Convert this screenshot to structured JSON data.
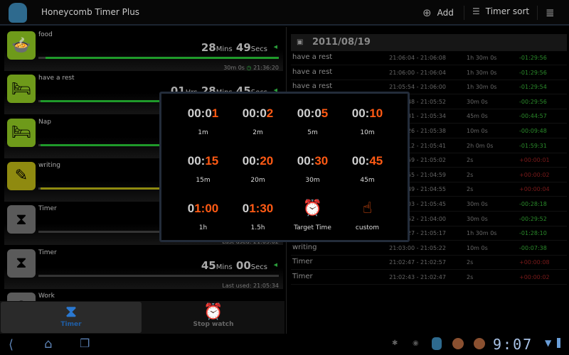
{
  "header": {
    "title": "Honeycomb Timer Plus",
    "add_label": "Add",
    "sort_label": "Timer sort"
  },
  "timers": [
    {
      "name": "food",
      "icon": "pot-icon",
      "color": "#6e9a1a",
      "bar": "#1f9a2a",
      "progress": 0.97,
      "h": null,
      "m": "28",
      "s": "49",
      "footer": "30m 0s",
      "end": "21:36:20"
    },
    {
      "name": "have a rest",
      "icon": "bed-icon",
      "color": "#6e9a1a",
      "bar": "#1f9a2a",
      "progress": 0.99,
      "h": "01",
      "m": "28",
      "s": "45",
      "footer": null
    },
    {
      "name": "Nap",
      "icon": "bed-icon",
      "color": "#6e9a1a",
      "bar": "#1f9a2a",
      "progress": 0.99,
      "footer": null
    },
    {
      "name": "writing",
      "icon": "writing-icon",
      "color": "#8f8a10",
      "bar": "#8f8a10",
      "progress": 0.99,
      "footer": null
    },
    {
      "name": "Timer",
      "icon": "hourglass-icon",
      "color": "#5a5a5a",
      "bar": "#333",
      "progress": 1,
      "footer": "Last used: 21:05:02"
    },
    {
      "name": "Timer",
      "icon": "hourglass-icon",
      "color": "#5a5a5a",
      "bar": "#333",
      "progress": 1,
      "m": "45",
      "s": "00",
      "footer": "Last used: 21:05:34"
    },
    {
      "name": "Work",
      "icon": "timer-icon",
      "color": "#5a5a5a",
      "bar": "#333",
      "progress": 1,
      "footer": null
    }
  ],
  "units": {
    "hrs": "Hrs",
    "mins": "Mins",
    "secs": "Secs"
  },
  "tabs": [
    {
      "label": "Timer",
      "active": true
    },
    {
      "label": "Stop watch",
      "active": false
    }
  ],
  "history": {
    "date": "2011/08/19",
    "rows": [
      {
        "name": "have a rest",
        "time": "21:06:04 - 21:06:08",
        "dur": "1h 30m 0s",
        "diff": "-01:29:56"
      },
      {
        "name": "have a rest",
        "time": "21:06:00 - 21:06:04",
        "dur": "1h 30m 0s",
        "diff": "-01:29:56"
      },
      {
        "name": "have a rest",
        "time": "21:05:54 - 21:06:00",
        "dur": "1h 30m 0s",
        "diff": "-01:29:54"
      },
      {
        "name": "",
        "time": ":48 - 21:05:52",
        "dur": "30m 0s",
        "diff": "-00:29:56"
      },
      {
        "name": "",
        "time": ":31 - 21:05:34",
        "dur": "45m 0s",
        "diff": "-00:44:57"
      },
      {
        "name": "",
        "time": ":26 - 21:05:38",
        "dur": "10m 0s",
        "diff": "-00:09:48"
      },
      {
        "name": "",
        "time": ":12 - 21:05:41",
        "dur": "2h 0m 0s",
        "diff": "-01:59:31"
      },
      {
        "name": "",
        "time": ":59 - 21:05:02",
        "dur": "2s",
        "diff": "+00:00:01"
      },
      {
        "name": "",
        "time": ":55 - 21:04:59",
        "dur": "2s",
        "diff": "+00:00:02"
      },
      {
        "name": "",
        "time": ":49 - 21:04:55",
        "dur": "2s",
        "diff": "+00:00:04"
      },
      {
        "name": "",
        "time": ":03 - 21:05:45",
        "dur": "30m 0s",
        "diff": "-00:28:18"
      },
      {
        "name": "",
        "time": ":52 - 21:04:00",
        "dur": "30m 0s",
        "diff": "-00:29:52"
      },
      {
        "name": "",
        "time": ":27 - 21:05:17",
        "dur": "1h 30m 0s",
        "diff": "-01:28:10"
      },
      {
        "name": "writing",
        "time": "21:03:00 - 21:05:22",
        "dur": "10m 0s",
        "diff": "-00:07:38"
      },
      {
        "name": "Timer",
        "time": "21:02:47 - 21:02:57",
        "dur": "2s",
        "diff": "+00:00:08"
      },
      {
        "name": "Timer",
        "time": "21:02:43 - 21:02:47",
        "dur": "2s",
        "diff": "+00:00:02"
      }
    ]
  },
  "colors": {
    "early": "#2a8a2a",
    "late": "#7a1a1a",
    "accent": "#ff5a14"
  },
  "presets": [
    {
      "pre": "00:0",
      "hi": "1",
      "label": "1m"
    },
    {
      "pre": "00:0",
      "hi": "2",
      "label": "2m"
    },
    {
      "pre": "00:0",
      "hi": "5",
      "label": "5m"
    },
    {
      "pre": "00:",
      "hi": "10",
      "label": "10m"
    },
    {
      "pre": "00:",
      "hi": "15",
      "label": "15m"
    },
    {
      "pre": "00:",
      "hi": "20",
      "label": "20m"
    },
    {
      "pre": "00:",
      "hi": "30",
      "label": "30m"
    },
    {
      "pre": "00:",
      "hi": "45",
      "label": "45m"
    },
    {
      "pre": "0",
      "hi": "1:00",
      "label": "1h"
    },
    {
      "pre": "0",
      "hi": "1:30",
      "label": "1.5h"
    },
    {
      "icon": "alarm-clock-icon",
      "label": "Target Time"
    },
    {
      "icon": "hand-pointer-icon",
      "label": "custom"
    }
  ],
  "status": {
    "clock": "9:07"
  }
}
